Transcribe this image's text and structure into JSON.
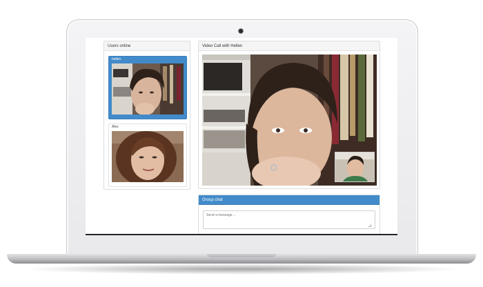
{
  "users_panel": {
    "title": "Users online",
    "users": [
      {
        "name": "hellen"
      },
      {
        "name": "Alex"
      }
    ]
  },
  "call_panel": {
    "title": "Video Call with Hellen"
  },
  "chat_panel": {
    "title": "Group chat",
    "input_placeholder": "Send a message ..."
  },
  "colors": {
    "accent": "#428bca",
    "panel_header": "#f5f5f5"
  },
  "icons": [
    "camera-dot-icon",
    "resize-grip-icon"
  ]
}
